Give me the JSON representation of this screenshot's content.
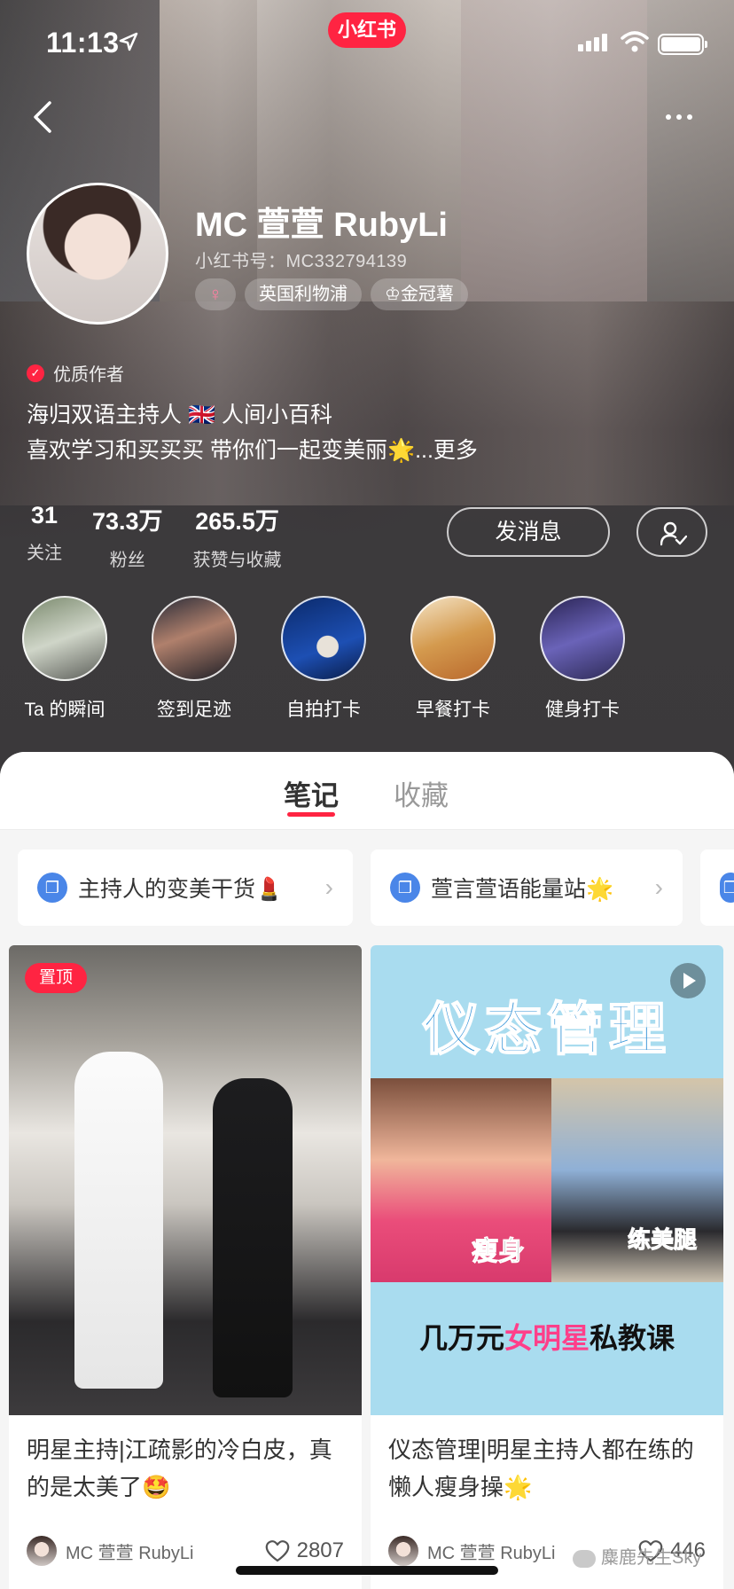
{
  "status_bar": {
    "time": "11:13",
    "app_badge": "小红书"
  },
  "profile": {
    "nickname": "MC 萱萱 RubyLi",
    "redbook_id": "小红书号：MC332794139",
    "gender_icon": "♀",
    "tags": [
      "英国利物浦",
      "金冠薯"
    ],
    "quality_label": "优质作者",
    "bio_lines": [
      "海归双语主持人 🇬🇧 人间小百科",
      "喜欢学习和买买买 带你们一起变美丽🌟...更多"
    ],
    "stats": [
      {
        "value": "31",
        "label": "关注"
      },
      {
        "value": "73.3万",
        "label": "粉丝"
      },
      {
        "value": "265.5万",
        "label": "获赞与收藏"
      }
    ],
    "message_button": "发消息"
  },
  "highlights": [
    {
      "label": "Ta 的瞬间"
    },
    {
      "label": "签到足迹"
    },
    {
      "label": "自拍打卡"
    },
    {
      "label": "早餐打卡"
    },
    {
      "label": "健身打卡"
    }
  ],
  "tabs": [
    {
      "label": "笔记",
      "active": true
    },
    {
      "label": "收藏",
      "active": false
    }
  ],
  "collections": [
    {
      "title": "主持人的变美干货💄"
    },
    {
      "title": "萱言萱语能量站🌟"
    }
  ],
  "notes": [
    {
      "badge": "置顶",
      "title": "明星主持|江疏影的冷白皮，真的是太美了🤩",
      "author": "MC 萱萱 RubyLi",
      "likes": "2807"
    },
    {
      "cover_title": "仪态管理",
      "cover_caption_left": "瘦身",
      "cover_caption_right": "练美腿",
      "cover_caption_bottom_a": "几万元",
      "cover_caption_bottom_b": "女明星",
      "cover_caption_bottom_c": "私教课",
      "title": "仪态管理|明星主持人都在练的懒人瘦身操🌟",
      "author": "MC 萱萱 RubyLi",
      "likes": "446"
    }
  ],
  "watermark": "麋鹿先生Sky",
  "colors": {
    "brand_red": "#ff2442",
    "hero_bg": "#3b393b",
    "collection_icon": "#4a86e8"
  }
}
